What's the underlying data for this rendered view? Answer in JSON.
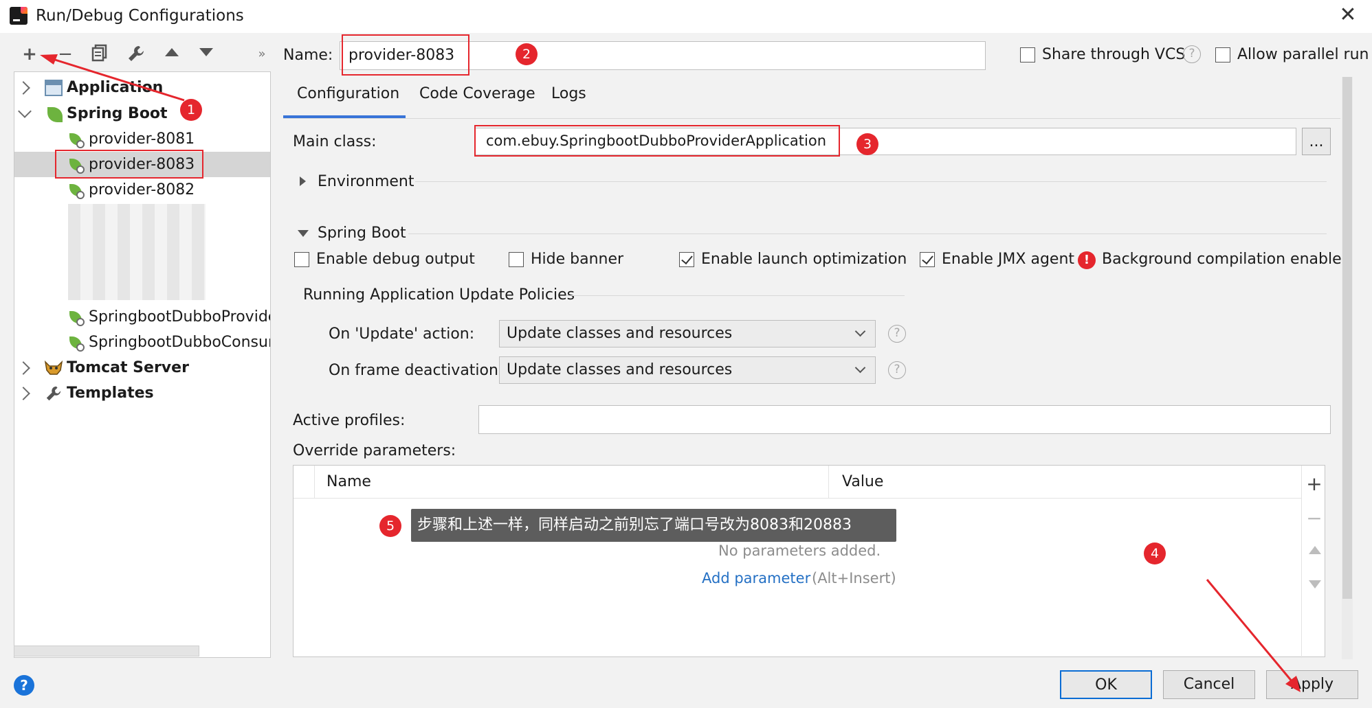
{
  "window": {
    "title": "Run/Debug Configurations"
  },
  "toolbar": {
    "add": "+",
    "remove": "−",
    "more": "»"
  },
  "tree": {
    "application": "Application",
    "spring_boot": "Spring Boot",
    "items": [
      "provider-8081",
      "provider-8083",
      "provider-8082"
    ],
    "items2": [
      "SpringbootDubboProvider",
      "SpringbootDubboConsum"
    ],
    "tomcat": "Tomcat Server",
    "templates": "Templates"
  },
  "name_field": {
    "label": "Name:",
    "value": "provider-8083"
  },
  "share": {
    "label": "Share through VCS",
    "checked": false
  },
  "parallel": {
    "label": "Allow parallel run",
    "checked": false
  },
  "tabs": [
    "Configuration",
    "Code Coverage",
    "Logs"
  ],
  "main_class": {
    "label": "Main class:",
    "value": "com.ebuy.SpringbootDubboProviderApplication",
    "browse": "..."
  },
  "environment": {
    "label": "Environment"
  },
  "spring_boot_section": {
    "label": "Spring Boot",
    "checks": [
      {
        "label": "Enable debug output",
        "checked": false
      },
      {
        "label": "Hide banner",
        "checked": false
      },
      {
        "label": "Enable launch optimization",
        "checked": true
      },
      {
        "label": "Enable JMX agent",
        "checked": true
      }
    ],
    "warning": "Background compilation enabled"
  },
  "policies": {
    "title": "Running Application Update Policies",
    "update_label": "On 'Update' action:",
    "update_value": "Update classes and resources",
    "frame_label": "On frame deactivation:",
    "frame_value": "Update classes and resources"
  },
  "active_profiles": {
    "label": "Active profiles:",
    "value": ""
  },
  "override": {
    "label": "Override parameters:",
    "col_name": "Name",
    "col_value": "Value",
    "empty": "No parameters added.",
    "add_link": "Add parameter",
    "add_hint": "(Alt+Insert)"
  },
  "annotation": {
    "tooltip": "步骤和上述一样，同样启动之前别忘了端口号改为8083和20883",
    "badges": [
      "1",
      "2",
      "3",
      "4",
      "5"
    ]
  },
  "buttons": {
    "ok": "OK",
    "cancel": "Cancel",
    "apply": "Apply"
  },
  "help": "?",
  "colors": {
    "accent": "#3874d8",
    "annotation_red": "#e5262d",
    "spring_green": "#6db33f",
    "link": "#2470c4"
  }
}
